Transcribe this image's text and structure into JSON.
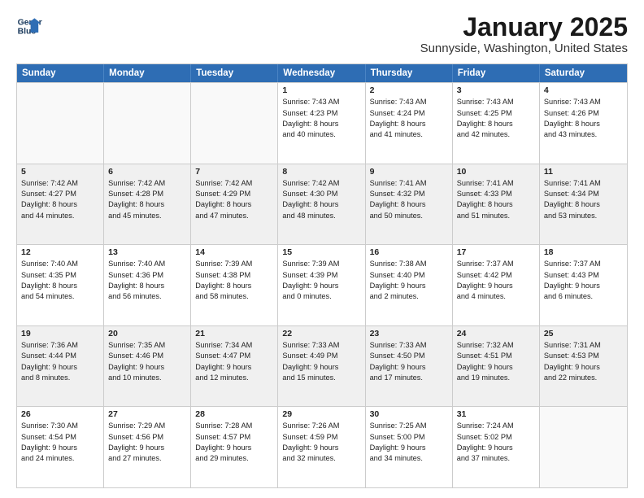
{
  "logo": {
    "line1": "General",
    "line2": "Blue"
  },
  "title": "January 2025",
  "subtitle": "Sunnyside, Washington, United States",
  "days": [
    "Sunday",
    "Monday",
    "Tuesday",
    "Wednesday",
    "Thursday",
    "Friday",
    "Saturday"
  ],
  "rows": [
    [
      {
        "day": "",
        "lines": [],
        "empty": true
      },
      {
        "day": "",
        "lines": [],
        "empty": true
      },
      {
        "day": "",
        "lines": [],
        "empty": true
      },
      {
        "day": "1",
        "lines": [
          "Sunrise: 7:43 AM",
          "Sunset: 4:23 PM",
          "Daylight: 8 hours",
          "and 40 minutes."
        ]
      },
      {
        "day": "2",
        "lines": [
          "Sunrise: 7:43 AM",
          "Sunset: 4:24 PM",
          "Daylight: 8 hours",
          "and 41 minutes."
        ]
      },
      {
        "day": "3",
        "lines": [
          "Sunrise: 7:43 AM",
          "Sunset: 4:25 PM",
          "Daylight: 8 hours",
          "and 42 minutes."
        ]
      },
      {
        "day": "4",
        "lines": [
          "Sunrise: 7:43 AM",
          "Sunset: 4:26 PM",
          "Daylight: 8 hours",
          "and 43 minutes."
        ]
      }
    ],
    [
      {
        "day": "5",
        "lines": [
          "Sunrise: 7:42 AM",
          "Sunset: 4:27 PM",
          "Daylight: 8 hours",
          "and 44 minutes."
        ],
        "shaded": true
      },
      {
        "day": "6",
        "lines": [
          "Sunrise: 7:42 AM",
          "Sunset: 4:28 PM",
          "Daylight: 8 hours",
          "and 45 minutes."
        ],
        "shaded": true
      },
      {
        "day": "7",
        "lines": [
          "Sunrise: 7:42 AM",
          "Sunset: 4:29 PM",
          "Daylight: 8 hours",
          "and 47 minutes."
        ],
        "shaded": true
      },
      {
        "day": "8",
        "lines": [
          "Sunrise: 7:42 AM",
          "Sunset: 4:30 PM",
          "Daylight: 8 hours",
          "and 48 minutes."
        ],
        "shaded": true
      },
      {
        "day": "9",
        "lines": [
          "Sunrise: 7:41 AM",
          "Sunset: 4:32 PM",
          "Daylight: 8 hours",
          "and 50 minutes."
        ],
        "shaded": true
      },
      {
        "day": "10",
        "lines": [
          "Sunrise: 7:41 AM",
          "Sunset: 4:33 PM",
          "Daylight: 8 hours",
          "and 51 minutes."
        ],
        "shaded": true
      },
      {
        "day": "11",
        "lines": [
          "Sunrise: 7:41 AM",
          "Sunset: 4:34 PM",
          "Daylight: 8 hours",
          "and 53 minutes."
        ],
        "shaded": true
      }
    ],
    [
      {
        "day": "12",
        "lines": [
          "Sunrise: 7:40 AM",
          "Sunset: 4:35 PM",
          "Daylight: 8 hours",
          "and 54 minutes."
        ]
      },
      {
        "day": "13",
        "lines": [
          "Sunrise: 7:40 AM",
          "Sunset: 4:36 PM",
          "Daylight: 8 hours",
          "and 56 minutes."
        ]
      },
      {
        "day": "14",
        "lines": [
          "Sunrise: 7:39 AM",
          "Sunset: 4:38 PM",
          "Daylight: 8 hours",
          "and 58 minutes."
        ]
      },
      {
        "day": "15",
        "lines": [
          "Sunrise: 7:39 AM",
          "Sunset: 4:39 PM",
          "Daylight: 9 hours",
          "and 0 minutes."
        ]
      },
      {
        "day": "16",
        "lines": [
          "Sunrise: 7:38 AM",
          "Sunset: 4:40 PM",
          "Daylight: 9 hours",
          "and 2 minutes."
        ]
      },
      {
        "day": "17",
        "lines": [
          "Sunrise: 7:37 AM",
          "Sunset: 4:42 PM",
          "Daylight: 9 hours",
          "and 4 minutes."
        ]
      },
      {
        "day": "18",
        "lines": [
          "Sunrise: 7:37 AM",
          "Sunset: 4:43 PM",
          "Daylight: 9 hours",
          "and 6 minutes."
        ]
      }
    ],
    [
      {
        "day": "19",
        "lines": [
          "Sunrise: 7:36 AM",
          "Sunset: 4:44 PM",
          "Daylight: 9 hours",
          "and 8 minutes."
        ],
        "shaded": true
      },
      {
        "day": "20",
        "lines": [
          "Sunrise: 7:35 AM",
          "Sunset: 4:46 PM",
          "Daylight: 9 hours",
          "and 10 minutes."
        ],
        "shaded": true
      },
      {
        "day": "21",
        "lines": [
          "Sunrise: 7:34 AM",
          "Sunset: 4:47 PM",
          "Daylight: 9 hours",
          "and 12 minutes."
        ],
        "shaded": true
      },
      {
        "day": "22",
        "lines": [
          "Sunrise: 7:33 AM",
          "Sunset: 4:49 PM",
          "Daylight: 9 hours",
          "and 15 minutes."
        ],
        "shaded": true
      },
      {
        "day": "23",
        "lines": [
          "Sunrise: 7:33 AM",
          "Sunset: 4:50 PM",
          "Daylight: 9 hours",
          "and 17 minutes."
        ],
        "shaded": true
      },
      {
        "day": "24",
        "lines": [
          "Sunrise: 7:32 AM",
          "Sunset: 4:51 PM",
          "Daylight: 9 hours",
          "and 19 minutes."
        ],
        "shaded": true
      },
      {
        "day": "25",
        "lines": [
          "Sunrise: 7:31 AM",
          "Sunset: 4:53 PM",
          "Daylight: 9 hours",
          "and 22 minutes."
        ],
        "shaded": true
      }
    ],
    [
      {
        "day": "26",
        "lines": [
          "Sunrise: 7:30 AM",
          "Sunset: 4:54 PM",
          "Daylight: 9 hours",
          "and 24 minutes."
        ]
      },
      {
        "day": "27",
        "lines": [
          "Sunrise: 7:29 AM",
          "Sunset: 4:56 PM",
          "Daylight: 9 hours",
          "and 27 minutes."
        ]
      },
      {
        "day": "28",
        "lines": [
          "Sunrise: 7:28 AM",
          "Sunset: 4:57 PM",
          "Daylight: 9 hours",
          "and 29 minutes."
        ]
      },
      {
        "day": "29",
        "lines": [
          "Sunrise: 7:26 AM",
          "Sunset: 4:59 PM",
          "Daylight: 9 hours",
          "and 32 minutes."
        ]
      },
      {
        "day": "30",
        "lines": [
          "Sunrise: 7:25 AM",
          "Sunset: 5:00 PM",
          "Daylight: 9 hours",
          "and 34 minutes."
        ]
      },
      {
        "day": "31",
        "lines": [
          "Sunrise: 7:24 AM",
          "Sunset: 5:02 PM",
          "Daylight: 9 hours",
          "and 37 minutes."
        ]
      },
      {
        "day": "",
        "lines": [],
        "empty": true
      }
    ]
  ]
}
